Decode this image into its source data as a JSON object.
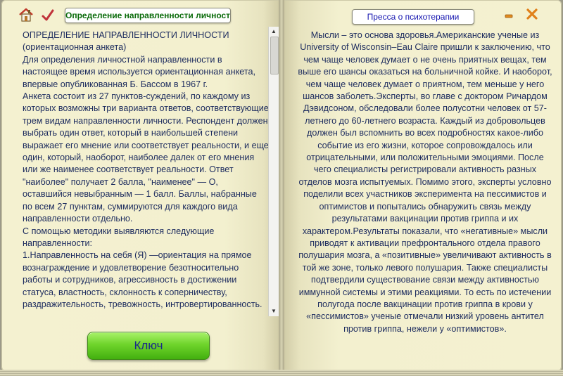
{
  "header": {
    "left_tab": "Определение направленности личности",
    "right_tab": "Пресса о психотерапии"
  },
  "left_page": {
    "text": "ОПРЕДЕЛЕНИЕ НАПРАВЛЕННОСТИ ЛИЧНОСТИ\n(ориентационная анкета)\nДля определения личностной направленности в настоящее время используется ориентационная анкета, впервые опубликованная Б. Бассом в 1967 г.\nАнкета состоит из 27 пунктов-суждений, по каждому из которых возможны три варианта ответов, соответствующие трем видам направленности личности. Респондент должен выбрать один ответ, который в наибольшей степени выражает его мнение или соответствует реальности, и еще один, который, наоборот, наиболее далек от его мнения или же наименее соответствует реальности. Ответ \"наиболее\" получает 2 балла, \"наименее\" — О, оставшийся невыбранным — 1 балл. Баллы, набранные по всем 27 пунктам, суммируются для каждого вида направленности отдельно.\nС помощью методики выявляются следующие направленности:\n1.Направленность на себя (Я) —ориентация на прямое вознаграждение и удовлетворение безотносительно работы и сотрудников, агрессивность в достижении статуса, властность, склонность к соперничеству, раздражительность, тревожность, интровертированность.",
    "key_button": "Ключ"
  },
  "right_page": {
    "text": "Мысли – это основа здоровья.Американские ученые из University of Wisconsin–Eau Claire пришли к заключению, что чем чаще человек думает о не очень приятных вещах, тем выше его шансы оказаться на больничной койке. И наоборот, чем чаще человек думает о приятном, тем меньше у него шансов заболеть.Эксперты, во главе с доктором Ричардом Дэвидсоном, обследовали более полусотни человек от 57-летнего до 60-летнего возраста. Каждый из добровольцев должен был вспомнить во всех подробностях какое-либо событие из его жизни, которое сопровождалось или отрицательными, или положительными эмоциями. После чего специалисты регистрировали активность разных отделов мозга испытуемых. Помимо этого, эксперты условно поделили всех участников эксперимента на пессимистов и оптимистов и попытались обнаружить связь между результатами вакцинации против гриппа и их характером.Результаты показали, что «негативные» мысли приводят к активации префронтального отдела правого полушария мозга, а «позитивные» увеличивают активность в той же зоне, только левого полушария. Также специалисты подтвердили существование связи между активностью иммунной системы и этими реакциями. То есть по истечении полугода после вакцинации против гриппа в крови у «пессимистов» ученые отмечали низкий уровень антител против гриппа, нежели у «оптимистов»."
  },
  "icons": {
    "home": "home-icon",
    "check": "checkmark-icon",
    "minimize": "minimize-icon",
    "close": "close-icon"
  },
  "colors": {
    "page": "#f3f0cf",
    "text": "#1c2b5e",
    "left_tab_text": "#0a6b0a",
    "right_tab_text": "#1515b0",
    "button": "#6fd42b"
  }
}
